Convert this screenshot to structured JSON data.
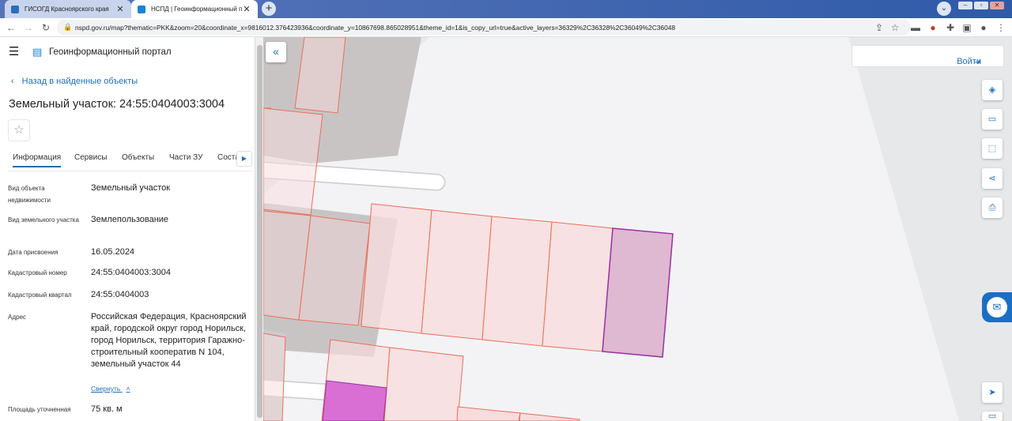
{
  "browser": {
    "tabs": [
      {
        "title": "ГИСОГД Красноярского края",
        "active": false,
        "favicon_color": "#2a6ebd"
      },
      {
        "title": "НСПД | Геоинформационный п",
        "active": true,
        "favicon_color": "#1a83d6"
      }
    ],
    "url": "nspd.gov.ru/map?thematic=PKK&zoom=20&coordinate_x=9816012.376423936&coordinate_y=10867698.865028951&theme_id=1&is_copy_url=true&active_layers=36329%2C36328%2C36049%2C36048"
  },
  "panel": {
    "portal_title": "Геоинформационный портал",
    "back_link": "Назад в найденные объекты",
    "object_title": "Земельный участок: 24:55:0404003:3004",
    "tabs": [
      "Информация",
      "Сервисы",
      "Объекты",
      "Части ЗУ",
      "Состав"
    ],
    "fields": [
      {
        "label": "Вид объекта недвижимости",
        "value": "Земельный участок"
      },
      {
        "label": "Вид земельного участка",
        "value": "Землепользование"
      },
      {
        "label": "Дата присвоения",
        "value": "16.05.2024"
      },
      {
        "label": "Кадастровый номер",
        "value": "24:55:0404003:3004"
      },
      {
        "label": "Кадастровый квартал",
        "value": "24:55:0404003"
      },
      {
        "label": "Адрес",
        "value": "Российская Федерация, Красноярский край, городской округ город Норильск, город Норильск, территория Гаражно-строительный кооператив N 104, земельный участок 44"
      },
      {
        "label": "Площадь уточненная",
        "value": "75 кв. м"
      }
    ],
    "collapse_link": "Свернуть"
  },
  "map": {
    "login_label": "Войти",
    "colors": {
      "parcel_outline": "#e9705a",
      "parcel_fill": "#f7dcdd",
      "selected_outline": "#9b2fa3",
      "selected_fill": "#dfb8d1",
      "highlight_fill": "#d96fd4",
      "building": "#c9c4c4"
    }
  }
}
